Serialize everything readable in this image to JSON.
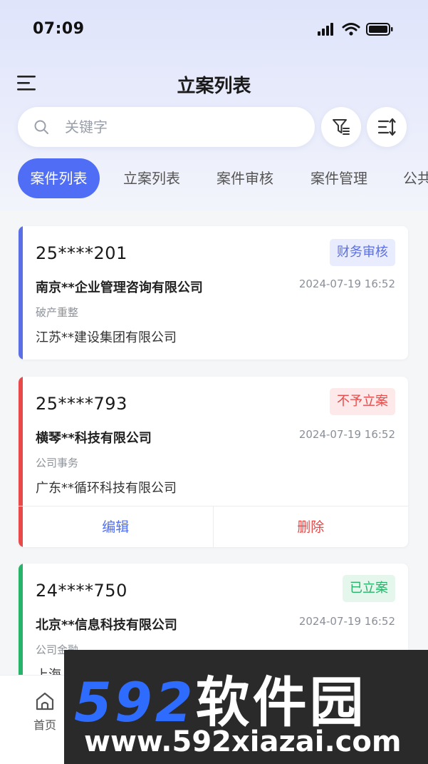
{
  "status_bar": {
    "time": "07:09"
  },
  "nav": {
    "title": "立案列表"
  },
  "search": {
    "placeholder": "关键字"
  },
  "tabs": [
    {
      "label": "案件列表",
      "active": true
    },
    {
      "label": "立案列表",
      "active": false
    },
    {
      "label": "案件审核",
      "active": false
    },
    {
      "label": "案件管理",
      "active": false
    },
    {
      "label": "公共",
      "active": false
    }
  ],
  "cards": [
    {
      "case_no": "25****201",
      "status": "财务审核",
      "company": "南京**企业管理咨询有限公司",
      "datetime": "2024-07-19 16:52",
      "type": "破产重整",
      "company2": "江苏**建设集团有限公司",
      "accent": "#5a6fe6",
      "badge_bg": "#e8ecfc",
      "badge_color": "#5a6fe6"
    },
    {
      "case_no": "25****793",
      "status": "不予立案",
      "company": "横琴**科技有限公司",
      "datetime": "2024-07-19 16:52",
      "type": "公司事务",
      "company2": "广东**循环科技有限公司",
      "accent": "#e84a4a",
      "badge_bg": "#fde9e9",
      "badge_color": "#e84a4a",
      "actions": {
        "edit": "编辑",
        "delete": "删除"
      }
    },
    {
      "case_no": "24****750",
      "status": "已立案",
      "company": "北京**信息科技有限公司",
      "datetime": "2024-07-19 16:52",
      "type": "公司金融",
      "company2": "上海",
      "accent": "#27b36a",
      "badge_bg": "#e5f6ec",
      "badge_color": "#27b36a"
    }
  ],
  "bottom_nav": {
    "home_label": "首页"
  },
  "watermark": {
    "brand_num": "592",
    "brand_cn": "软件园",
    "url": "www.592xiazai.com"
  },
  "icons": [
    "menu-icon",
    "search-icon",
    "filter-icon",
    "sort-icon",
    "home-icon",
    "signal-icon",
    "wifi-icon",
    "battery-icon"
  ]
}
